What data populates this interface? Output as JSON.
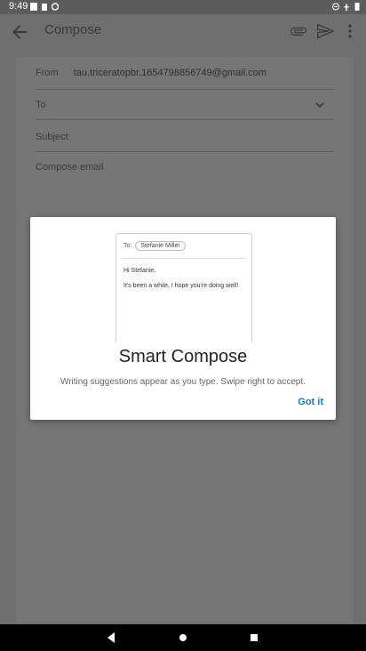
{
  "status_bar": {
    "time": "9:49"
  },
  "app_bar": {
    "title": "Compose"
  },
  "compose": {
    "from_label": "From",
    "from_value": "tau.triceratopbr.1654798856749@gmail.com",
    "to_label": "To",
    "subject_placeholder": "Subject",
    "body_placeholder": "Compose email"
  },
  "dialog": {
    "illustration": {
      "to_label": "To:",
      "recipient_chip": "Stefanie Miller",
      "greeting": "Hi Stefanie,",
      "message": "It's been a while, I hope you're doing well!"
    },
    "title": "Smart Compose",
    "description": "Writing suggestions appear as you type. Swipe right to accept.",
    "got_it_label": "Got it"
  }
}
